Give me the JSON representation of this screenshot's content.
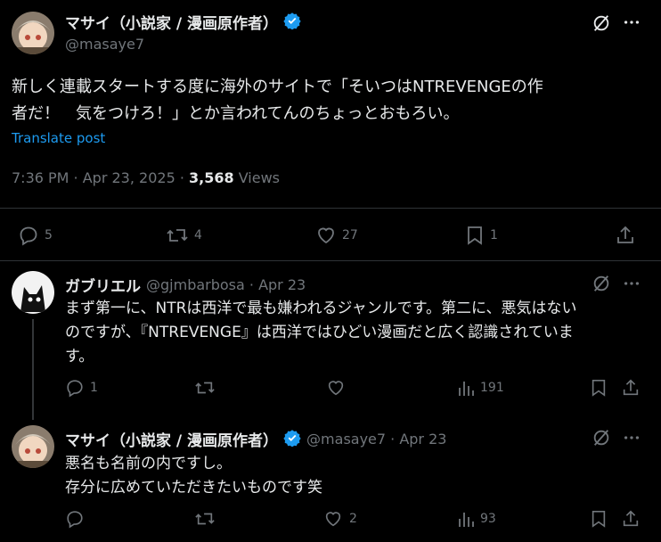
{
  "main_post": {
    "author_name": "マサイ（小説家 / 漫画原作者）",
    "handle": "@masaye7",
    "text_line1": "新しく連載スタートする度に海外のサイトで「そいつはNTREVENGEの作",
    "text_line2": "者だ！　気をつけろ！」とか言われてんのちょっとおもろい。",
    "translate": "Translate post",
    "time": "7:36 PM · Apr 23, 2025 · ",
    "views_count": "3,568",
    "views_label": " Views",
    "replies": "5",
    "reposts": "4",
    "likes": "27",
    "bookmarks": "1"
  },
  "reply1": {
    "author_name": "ガブリエル",
    "handle_date": "@gjmbarbosa · Apr 23",
    "text_line1": "まず第一に、NTRは西洋で最も嫌われるジャンルです。第二に、悪気はない",
    "text_line2": "のですが、『NTREVENGE』は西洋ではひどい漫画だと広く認識されていま",
    "text_line3": "す。",
    "replies": "1",
    "views": "191"
  },
  "reply2": {
    "author_name": "マサイ（小説家 / 漫画原作者）",
    "handle_date": "@masaye7 · Apr 23",
    "text_line1": "悪名も名前の内ですし。",
    "text_line2": "存分に広めていただきたいものです笑",
    "likes": "2",
    "views": "93"
  },
  "colors": {
    "accent": "#1d9bf0",
    "muted": "#71767b",
    "bg": "#000000"
  }
}
